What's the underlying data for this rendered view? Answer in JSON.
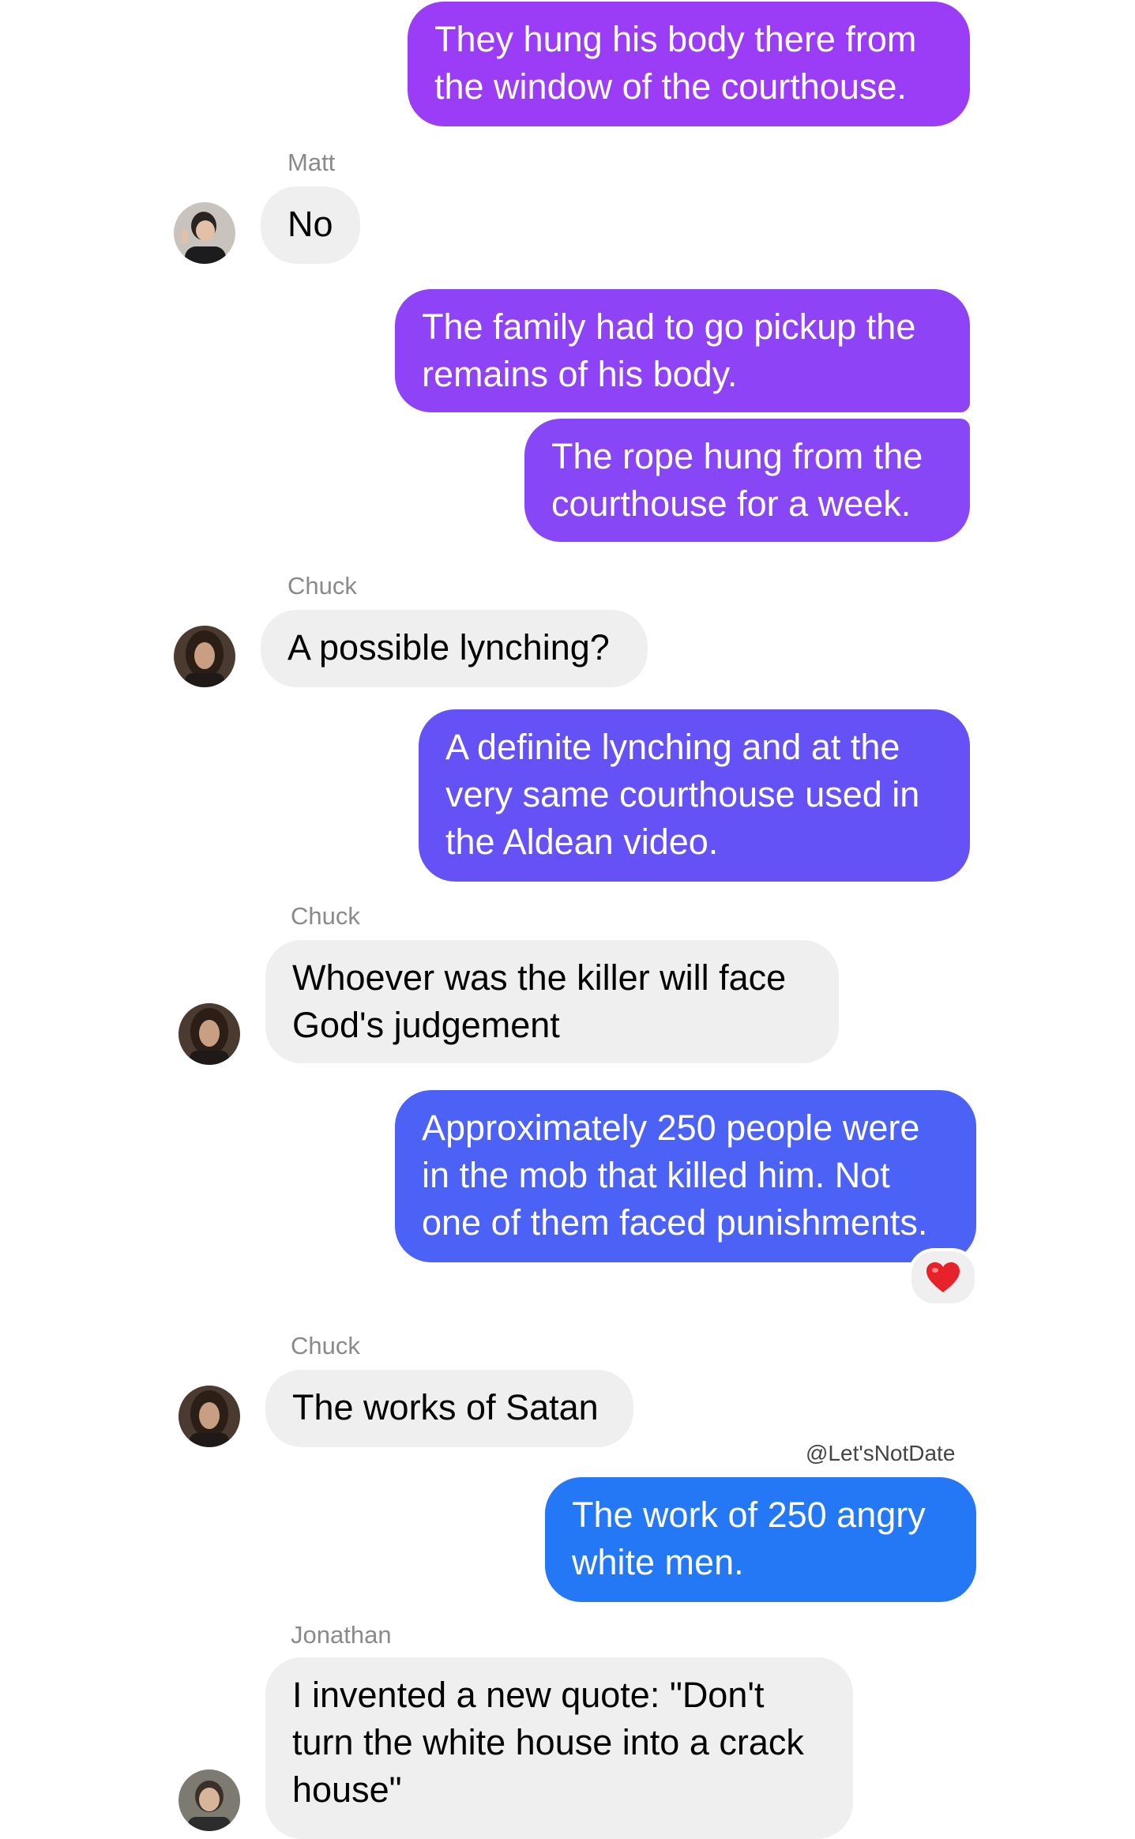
{
  "colors": {
    "outgoing_gradient_top": "#9a3cf6",
    "outgoing_gradient_bottom": "#1e7cf6",
    "incoming_bubble": "#efefef",
    "sender_label": "#8a8a8a",
    "reaction_heart": "#e8222a"
  },
  "messages": [
    {
      "direction": "out",
      "text": "They hung his body there from\nthe window of the courthouse."
    },
    {
      "direction": "in",
      "sender": "Matt",
      "text": "No",
      "avatar": "user-photo-icon"
    },
    {
      "direction": "out",
      "text": "The family had to go pickup the\nremains of his body."
    },
    {
      "direction": "out",
      "text": "The rope hung from the\ncourthouse for a week."
    },
    {
      "direction": "in",
      "sender": "Chuck",
      "text": "A possible lynching?",
      "avatar": "user-photo-icon"
    },
    {
      "direction": "out",
      "text": "A definite lynching and at the\nvery same courthouse used in\nthe Aldean video."
    },
    {
      "direction": "in",
      "sender": "Chuck",
      "text": "Whoever was the killer will face\nGod's judgement",
      "avatar": "user-photo-icon"
    },
    {
      "direction": "out",
      "text": "Approximately 250 people were\nin the mob that killed him. Not\none of them faced punishments.",
      "reaction": "heart-icon"
    },
    {
      "direction": "in",
      "sender": "Chuck",
      "text": "The works of Satan",
      "avatar": "user-photo-icon"
    },
    {
      "direction": "out",
      "text": "The work of 250 angry\nwhite men."
    },
    {
      "direction": "in",
      "sender": "Jonathan",
      "text": "I invented a new quote: \"Don't\nturn the white house into a crack\nhouse\"",
      "avatar": "user-photo-icon"
    }
  ],
  "watermark": "@Let'sNotDate"
}
